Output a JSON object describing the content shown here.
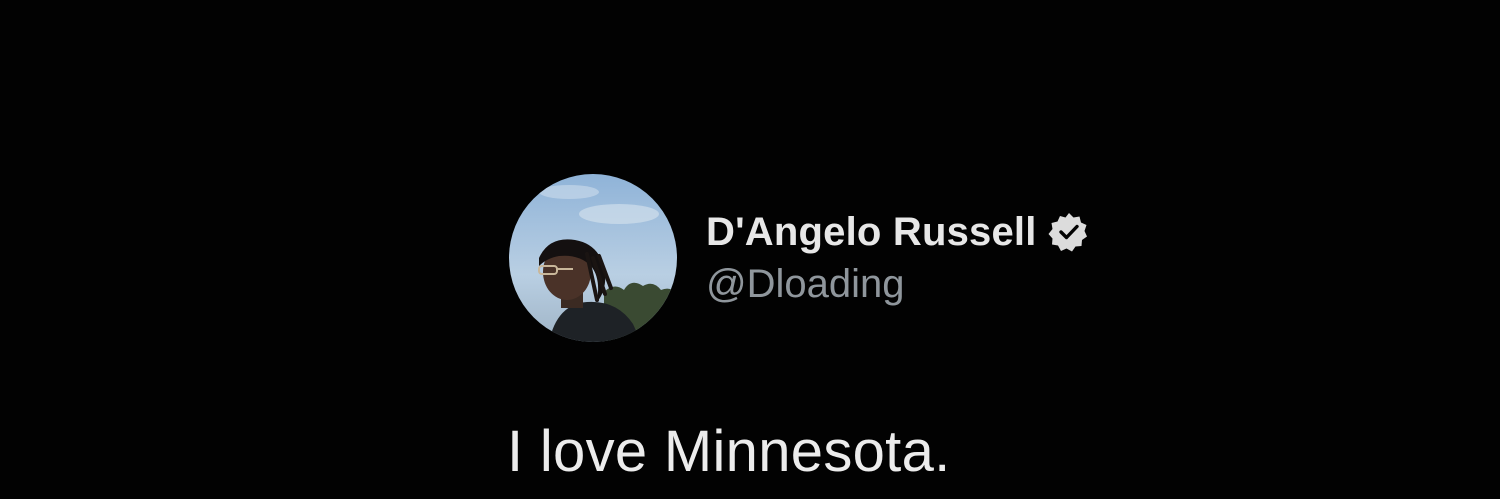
{
  "tweet": {
    "display_name": "D'Angelo Russell",
    "handle": "@Dloading",
    "verified": true,
    "verified_icon": "verified-badge-icon",
    "text": "I love Minnesota.",
    "avatar_icon": "profile-photo"
  },
  "colors": {
    "background": "#020202",
    "name": "#e7e7e7",
    "handle": "#8f969c",
    "text": "#ececec"
  }
}
